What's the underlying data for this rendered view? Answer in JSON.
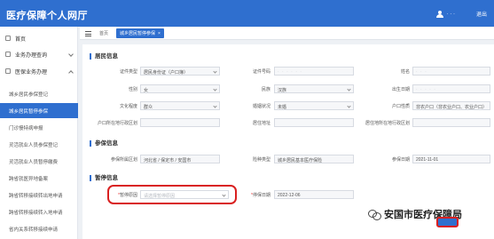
{
  "header": {
    "title": "医疗保障个人网厅",
    "user_label": "· · ·",
    "logout_label": "退出"
  },
  "sidebar": {
    "items": [
      {
        "label": "首页"
      },
      {
        "label": "业务办理查询"
      },
      {
        "label": "医保业务办理"
      }
    ],
    "sub_items": [
      {
        "label": "城乡居民参保登记"
      },
      {
        "label": "城乡居民暂停参保"
      },
      {
        "label": "门诊慢特病申报"
      },
      {
        "label": "灵活就业人员参保登记"
      },
      {
        "label": "灵活就业人员暂停缴费"
      },
      {
        "label": "跨省就医异地备案"
      },
      {
        "label": "跨省转移接续转出地申请"
      },
      {
        "label": "跨省转移接续转入地申请"
      },
      {
        "label": "省内关系转移接续申请"
      }
    ]
  },
  "tabs": {
    "home": "首页",
    "current": "城乡居民暂停参保",
    "close": "×"
  },
  "sections": {
    "resident_info": "居民信息",
    "insured_info": "参保信息",
    "suspend_info": "暂停信息"
  },
  "resident": {
    "id_type_label": "证件类型",
    "id_type_value": "居民身份证（户口簿）",
    "id_no_label": "证件号码",
    "id_no_value": "· · · · · ·",
    "name_label": "姓名",
    "name_value": "· · ·",
    "gender_label": "性别",
    "gender_value": "女",
    "ethnicity_label": "民族",
    "ethnicity_value": "汉族",
    "birth_label": "出生日期",
    "birth_value": "· · · · ·",
    "education_label": "文化程度",
    "education_value": "群众",
    "marital_label": "婚姻状况",
    "marital_value": "未婚",
    "hukou_label": "户口性质",
    "hukou_value": "非农户口（非农业户口、农业户口）",
    "hukou_code_label": "户口所在地行政区划",
    "hukou_code_value": "",
    "residence_label": "居住地址",
    "residence_value": "",
    "residence_code_label": "居住地所在地行政区划",
    "residence_code_value": ""
  },
  "insured": {
    "region_label": "参保所属区划",
    "region_value": "河北省 / 保定市 / 安国市",
    "type_label": "险种类型",
    "type_value": "城乡居民基本医疗保险",
    "date_label": "参保日期",
    "date_value": "2021-11-01"
  },
  "suspend": {
    "reason_label": "暂停原因",
    "reason_placeholder": "请选择暂停原因",
    "date_label": "停保日期",
    "date_value": "2022-12-06"
  },
  "watermark": {
    "text": "安国市医疗保障局"
  },
  "colors": {
    "primary": "#2f6fcf",
    "highlight": "#d92020"
  }
}
